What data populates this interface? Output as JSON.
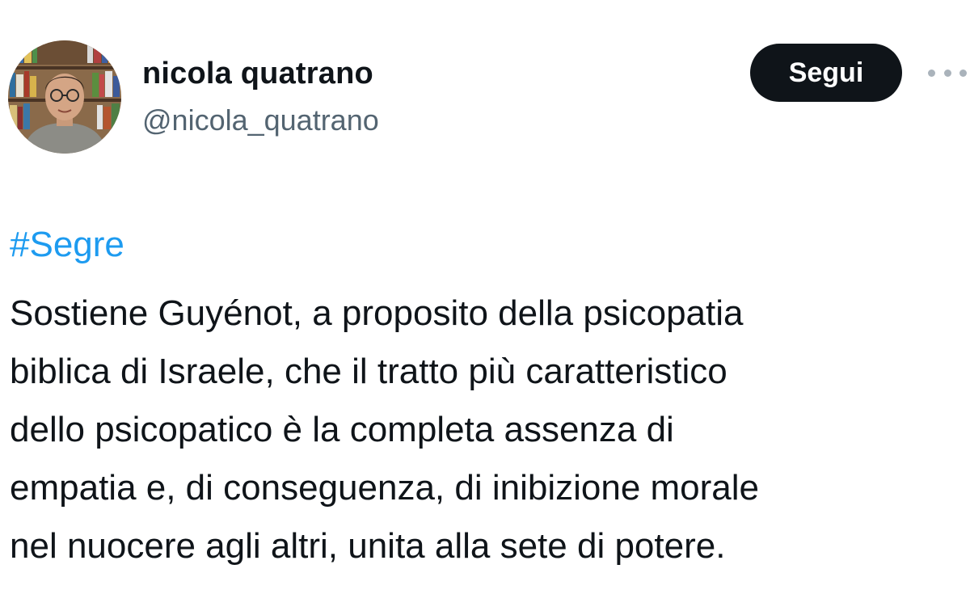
{
  "user": {
    "display_name": "nicola quatrano",
    "handle": "@nicola_quatrano"
  },
  "actions": {
    "follow_label": "Segui",
    "more_icon": "more-horizontal-icon"
  },
  "tweet": {
    "hashtag": "#Segre",
    "lines": [
      "Sostiene Guyénot, a proposito della psicopatia",
      "biblica di Israele, che il tratto più caratteristico",
      "dello psicopatico è la completa assenza di",
      "empatia e, di conseguenza, di inibizione morale",
      "nel nuocere agli altri, unita alla sete di potere."
    ]
  },
  "colors": {
    "hashtag": "#1d9bf0",
    "handle": "#536471",
    "follow_button_bg": "#0f1419",
    "text": "#0f1419"
  }
}
